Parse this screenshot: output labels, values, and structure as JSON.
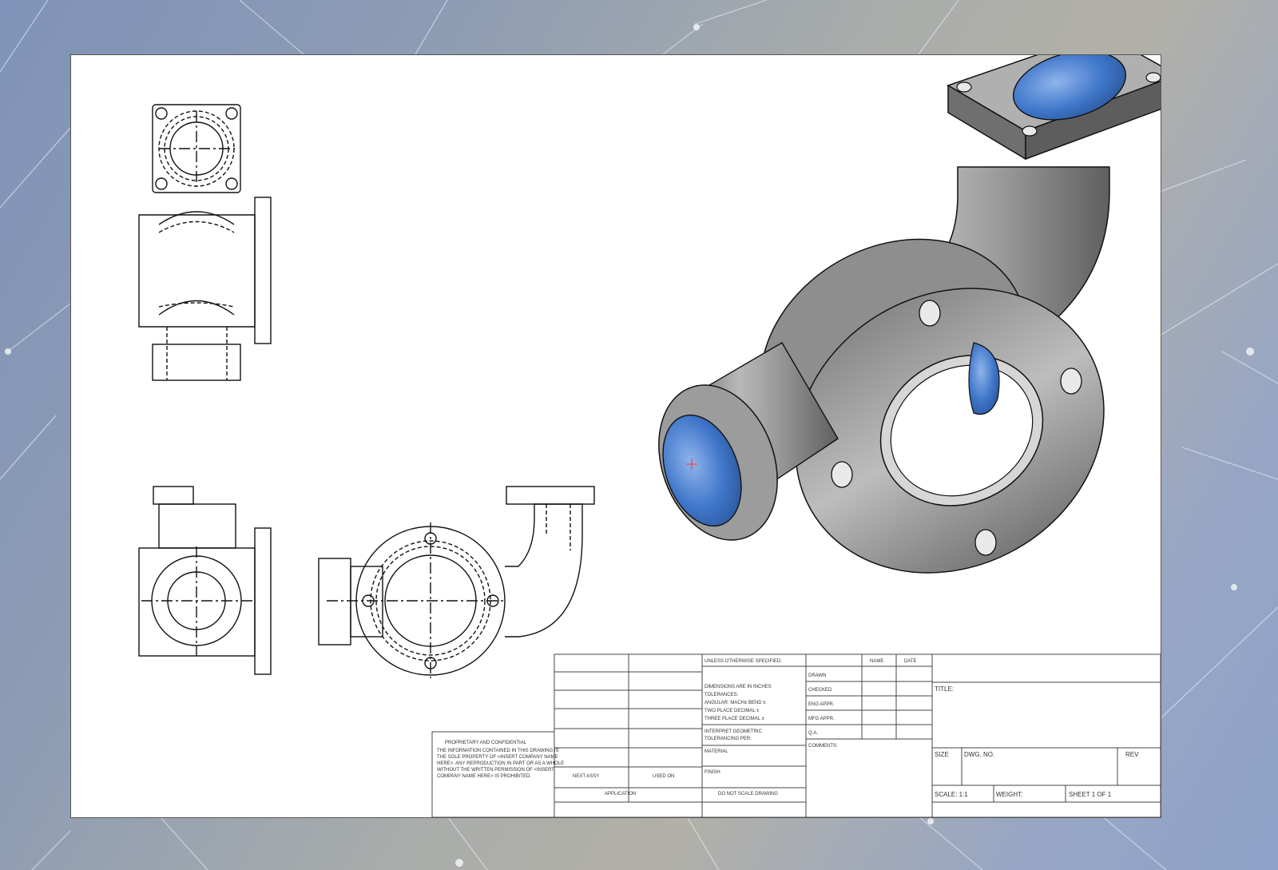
{
  "proprietary": {
    "heading": "PROPRIETARY AND CONFIDENTIAL",
    "lines": [
      "THE INFORMATION CONTAINED IN THIS DRAWING IS",
      "THE SOLE PROPERTY OF <INSERT COMPANY NAME",
      "HERE>. ANY REPRODUCTION IN PART OR AS A WHOLE",
      "WITHOUT THE WRITTEN PERMISSION OF <INSERT",
      "COMPANY NAME HERE> IS PROHIBITED."
    ]
  },
  "tolerances": {
    "unless": "UNLESS OTHERWISE SPECIFIED:",
    "lines": [
      "DIMENSIONS ARE IN INCHES",
      "TOLERANCES:",
      "ANGULAR: MACH± BEND ±",
      "TWO PLACE DECIMAL ±",
      "THREE PLACE DECIMAL ±"
    ],
    "interpret": [
      "INTERPRET GEOMETRIC",
      "TOLERANCING PER:"
    ],
    "material": "MATERIAL",
    "finish": "FINISH",
    "do_not_scale": "DO NOT SCALE DRAWING"
  },
  "assy": {
    "next_assy": "NEXT ASSY",
    "used_on": "USED ON",
    "application": "APPLICATION"
  },
  "approvals": {
    "name": "NAME",
    "date": "DATE",
    "rows": [
      "DRAWN",
      "CHECKED",
      "ENG APPR.",
      "MFG APPR.",
      "Q.A."
    ],
    "comments": "COMMENTS:"
  },
  "title_block": {
    "title": "TITLE:",
    "size": "SIZE",
    "dwg_no": "DWG.  NO.",
    "rev": "REV",
    "scale": "SCALE: 1:1",
    "weight": "WEIGHT:",
    "sheet": "SHEET 1 OF 1"
  },
  "colors": {
    "part_grey": "#9a9a9a",
    "bore_blue": "#3f76c9",
    "line": "#111111"
  }
}
